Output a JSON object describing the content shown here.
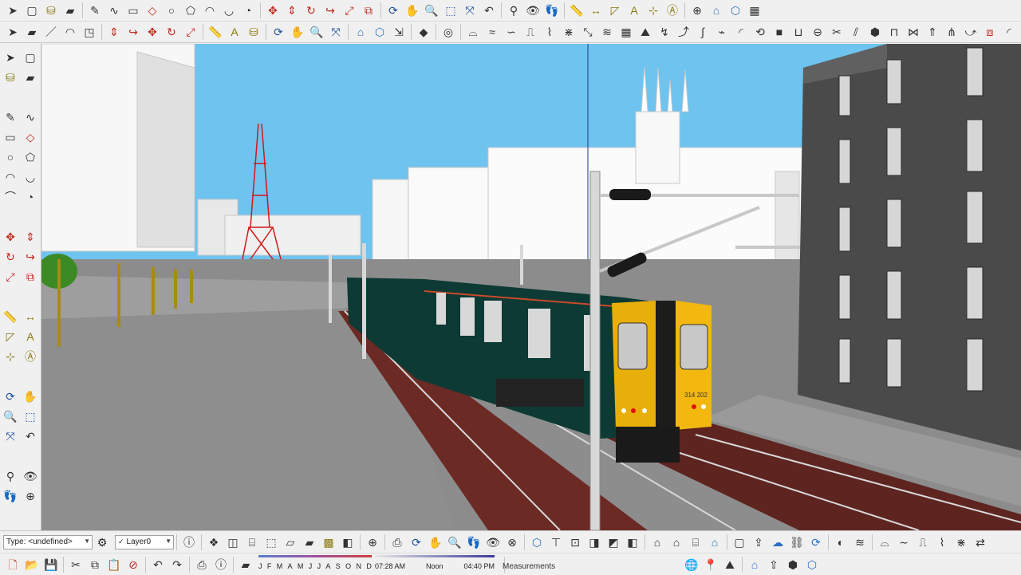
{
  "toolbar_top": {
    "row1_icons": [
      "select-icon",
      "component-icon",
      "paint-bucket-icon",
      "eraser-icon",
      "sep",
      "pencil-icon",
      "freehand-icon",
      "rectangle-icon",
      "rotated-rectangle-icon",
      "circle-icon",
      "polygon-icon",
      "arc-icon",
      "two-point-arc-icon",
      "pie-icon",
      "sep",
      "move-icon",
      "push-pull-icon",
      "rotate-icon",
      "follow-me-icon",
      "scale-icon",
      "offset-icon",
      "sep",
      "orbit-icon",
      "pan-icon",
      "zoom-icon",
      "zoom-window-icon",
      "zoom-extents-icon",
      "previous-view-icon",
      "sep",
      "position-camera-icon",
      "look-around-icon",
      "walk-icon",
      "sep",
      "tape-measure-icon",
      "dimension-icon",
      "protractor-icon",
      "text-icon",
      "axes-icon",
      "3d-text-icon",
      "sep",
      "section-plane-icon",
      "warehouse-icon",
      "extension-warehouse-icon",
      "layout-icon"
    ],
    "row2_icons": [
      "select-icon",
      "eraser-icon",
      "line-icon",
      "arc-icon",
      "shape-icon",
      "sep",
      "push-pull-icon",
      "follow-me-icon",
      "move-icon",
      "rotate-icon",
      "scale-icon",
      "sep",
      "tape-measure-icon",
      "text-icon",
      "paint-bucket-icon",
      "sep",
      "orbit-icon",
      "pan-icon",
      "zoom-icon",
      "zoom-extents-icon",
      "sep",
      "warehouse-icon",
      "extension-icon",
      "send-to-layout-icon",
      "sep",
      "ruby-console-icon",
      "sep",
      "account-icon",
      "sep",
      "sandbox-icon",
      "draw-icon",
      "smoove-icon",
      "stamp-icon",
      "drape-icon",
      "add-detail-icon",
      "flip-edge-icon",
      "contour-icon",
      "grid-icon",
      "terrain-icon",
      "curve-icon",
      "bend-icon",
      "spline-icon",
      "polyline-icon",
      "arc-tool-icon",
      "helix-icon",
      "solid-icon",
      "union-icon",
      "subtract-icon",
      "trim-icon",
      "split-icon",
      "outer-shell-icon",
      "intersect-icon",
      "weld-icon",
      "extrude-icon",
      "loft-icon",
      "sweep-icon",
      "offset-tool-icon",
      "round-corner-icon"
    ]
  },
  "toolbar_left": {
    "icons": [
      "select-icon",
      "component-icon",
      "paint-bucket-icon",
      "eraser-icon",
      "gap",
      "pencil-icon",
      "freehand-icon",
      "rectangle-icon",
      "rotated-rectangle-icon",
      "circle-icon",
      "polygon-icon",
      "arc-icon",
      "two-point-arc-icon",
      "three-point-arc-icon",
      "pie-icon",
      "gap",
      "move-icon",
      "push-pull-icon",
      "rotate-icon",
      "follow-me-icon",
      "scale-icon",
      "offset-icon",
      "gap",
      "tape-measure-icon",
      "dimension-icon",
      "protractor-icon",
      "text-icon",
      "axes-icon",
      "3d-text-icon",
      "gap",
      "orbit-icon",
      "pan-icon",
      "zoom-icon",
      "zoom-window-icon",
      "zoom-extents-icon",
      "previous-view-icon",
      "gap",
      "position-camera-icon",
      "look-around-icon",
      "walk-icon",
      "section-plane-icon"
    ]
  },
  "scene": {
    "sky_color": "#6ec3ef",
    "ground_color": "#8c8c8c",
    "train_number": "314 202",
    "train_body_color": "#0d3a34",
    "train_cab_color": "#f2b80f"
  },
  "status_bar": {
    "entity_type": "Type: <undefined>",
    "layer_value": "Layer0",
    "months": [
      "J",
      "F",
      "M",
      "A",
      "M",
      "J",
      "J",
      "A",
      "S",
      "O",
      "N",
      "D"
    ],
    "time_start": "07:28 AM",
    "time_noon": "Noon",
    "time_end": "04:40 PM",
    "measurements_label": "Measurements"
  },
  "bottom_icons": {
    "row1": [
      "entity-info-icon",
      "sep",
      "styles-icon",
      "xray-icon",
      "back-edges-icon",
      "wireframe-icon",
      "hidden-line-icon",
      "shaded-icon",
      "shaded-textures-icon",
      "monochrome-icon",
      "sep",
      "section-plane-icon",
      "sep",
      "camera-icon",
      "orbit-icon",
      "pan-icon",
      "zoom-icon",
      "walk-icon",
      "look-icon",
      "clear-icon",
      "sep",
      "iso-icon",
      "top-icon",
      "front-icon",
      "right-icon",
      "back-icon",
      "left-icon",
      "sep",
      "home-icon",
      "house-icon",
      "shop-icon",
      "warehouse-icon",
      "sep",
      "component-icon",
      "export-icon",
      "cloud-icon",
      "link-icon",
      "sync-icon",
      "sep",
      "shadow-icon",
      "fog-icon",
      "sep",
      "sandbox-icon",
      "smooth-icon",
      "stamp-icon",
      "drape-icon",
      "add-detail-icon",
      "flip-icon"
    ],
    "row2": [
      "new-icon",
      "open-icon",
      "save-icon",
      "sep",
      "cut-icon",
      "copy-icon",
      "paste-icon",
      "delete-icon",
      "sep",
      "undo-icon",
      "redo-icon",
      "sep",
      "print-icon",
      "model-info-icon",
      "sep",
      "eraser-icon"
    ],
    "row2_right": [
      "geo-icon",
      "location-icon",
      "terrain-icon",
      "sep",
      "warehouse-icon",
      "share-icon",
      "component-share-icon",
      "extension-icon"
    ]
  }
}
